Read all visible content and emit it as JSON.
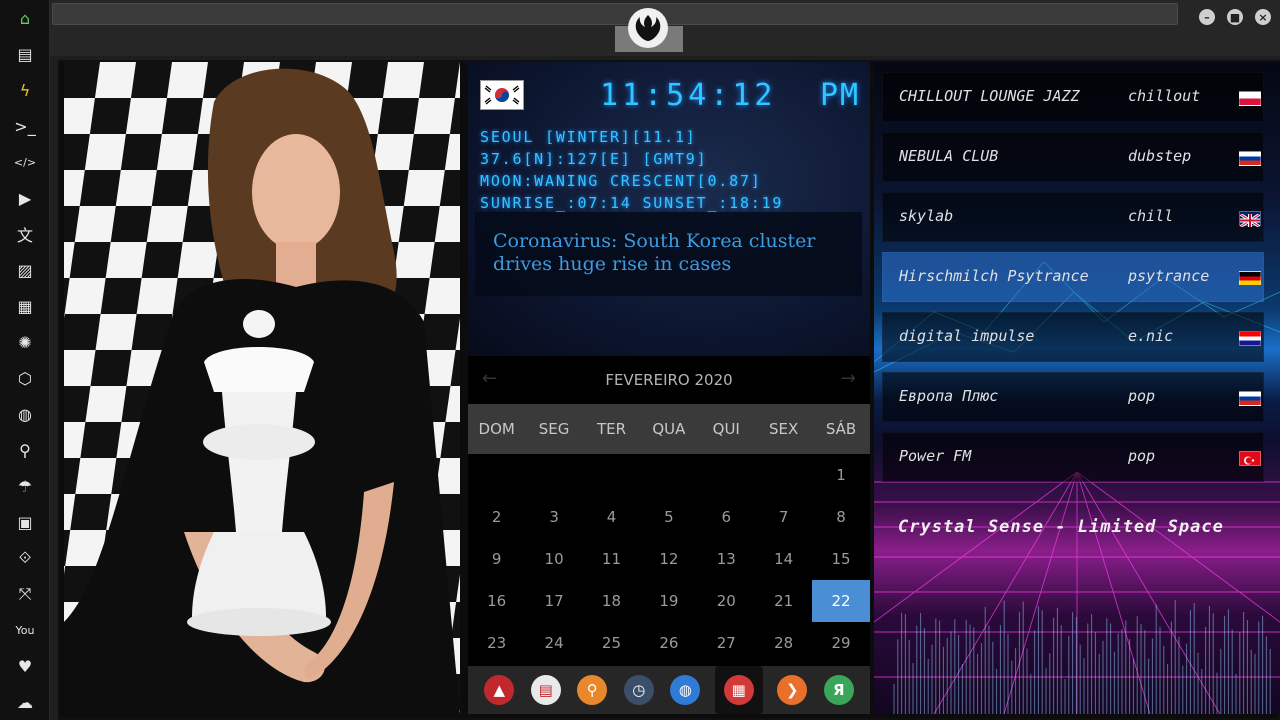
{
  "sidebar": {
    "items": [
      {
        "name": "home-icon",
        "glyph": "⌂",
        "color": "#5fd35f"
      },
      {
        "name": "document-icon",
        "glyph": "▤"
      },
      {
        "name": "lightning-icon",
        "glyph": "ϟ",
        "color": "#f0c020"
      },
      {
        "name": "terminal-icon",
        "glyph": ">_"
      },
      {
        "name": "code-icon",
        "glyph": "</>"
      },
      {
        "name": "play-icon",
        "glyph": "▶"
      },
      {
        "name": "translate-icon",
        "glyph": "文"
      },
      {
        "name": "image-icon",
        "glyph": "▨"
      },
      {
        "name": "news-icon",
        "glyph": "▦"
      },
      {
        "name": "rebel-icon",
        "glyph": "✺"
      },
      {
        "name": "hexagon-icon",
        "glyph": "⬡"
      },
      {
        "name": "globe-icon",
        "glyph": "◍"
      },
      {
        "name": "search-icon",
        "glyph": "⚲"
      },
      {
        "name": "umbrella-icon",
        "glyph": "☂"
      },
      {
        "name": "contact-icon",
        "glyph": "▣"
      },
      {
        "name": "link-icon",
        "glyph": "⟐"
      },
      {
        "name": "expand-icon",
        "glyph": "⤧"
      },
      {
        "name": "youtube-icon",
        "glyph": "You"
      },
      {
        "name": "heart-icon",
        "glyph": "♥"
      },
      {
        "name": "cloud-icon",
        "glyph": "☁"
      }
    ]
  },
  "clock": {
    "time": "11:54:12",
    "ampm": "PM",
    "line1": "SEOUL [WINTER][11.1]",
    "line2": "37.6[N]:127[E] [GMT9]",
    "line3": "MOON:WANING CRESCENT[0.87]",
    "line4": "SUNRISE_:07:14 SUNSET_:18:19"
  },
  "news": {
    "headline": "Coronavirus: South Korea cluster drives huge rise in cases"
  },
  "calendar": {
    "month_label": "FEVEREIRO 2020",
    "prev": "←",
    "next": "→",
    "weekdays": [
      "DOM",
      "SEG",
      "TER",
      "QUA",
      "QUI",
      "SEX",
      "SÁB"
    ],
    "weeks": [
      [
        "",
        "",
        "",
        "",
        "",
        "",
        "1"
      ],
      [
        "2",
        "3",
        "4",
        "5",
        "6",
        "7",
        "8"
      ],
      [
        "9",
        "10",
        "11",
        "12",
        "13",
        "14",
        "15"
      ],
      [
        "16",
        "17",
        "18",
        "19",
        "20",
        "21",
        "22"
      ],
      [
        "23",
        "24",
        "25",
        "26",
        "27",
        "28",
        "29"
      ]
    ],
    "today": "22"
  },
  "dock": {
    "items": [
      {
        "name": "app-launcher-icon",
        "glyph": "▲",
        "color": "#c0282d"
      },
      {
        "name": "feed-reader-icon",
        "glyph": "▤",
        "color": "#e9e9e9"
      },
      {
        "name": "search-app-icon",
        "glyph": "⚲",
        "color": "#e8872c"
      },
      {
        "name": "clock-app-icon",
        "glyph": "◷",
        "color": "#3b4f6a"
      },
      {
        "name": "browser-globe-icon",
        "glyph": "◍",
        "color": "#2f7bd6"
      },
      {
        "name": "calendar-app-icon",
        "glyph": "▦",
        "color": "#d23a3a"
      },
      {
        "name": "forward-arrow-icon",
        "glyph": "❯",
        "color": "#e8702a"
      },
      {
        "name": "yandex-icon",
        "glyph": "Я",
        "color": "#3aa65a"
      }
    ]
  },
  "radio": {
    "stations": [
      {
        "name": "CHILLOUT LOUNGE JAZZ",
        "genre": "chillout",
        "flag": "poland"
      },
      {
        "name": "NEBULA CLUB",
        "genre": "dubstep",
        "flag": "russia"
      },
      {
        "name": "skylab",
        "genre": "chill",
        "flag": "uk"
      },
      {
        "name": "Hirschmilch Psytrance",
        "genre": "psytrance",
        "flag": "germany"
      },
      {
        "name": "digital impulse",
        "genre": "e.nic",
        "flag": "croatia"
      },
      {
        "name": "Европа Плюс",
        "genre": "pop",
        "flag": "russia"
      },
      {
        "name": "Power FM",
        "genre": "pop",
        "flag": "turkey"
      }
    ],
    "selected": 3,
    "now_playing": "Crystal Sense - Limited Space"
  },
  "window": {
    "minimize": "–",
    "maximize": "■",
    "close": "×"
  }
}
